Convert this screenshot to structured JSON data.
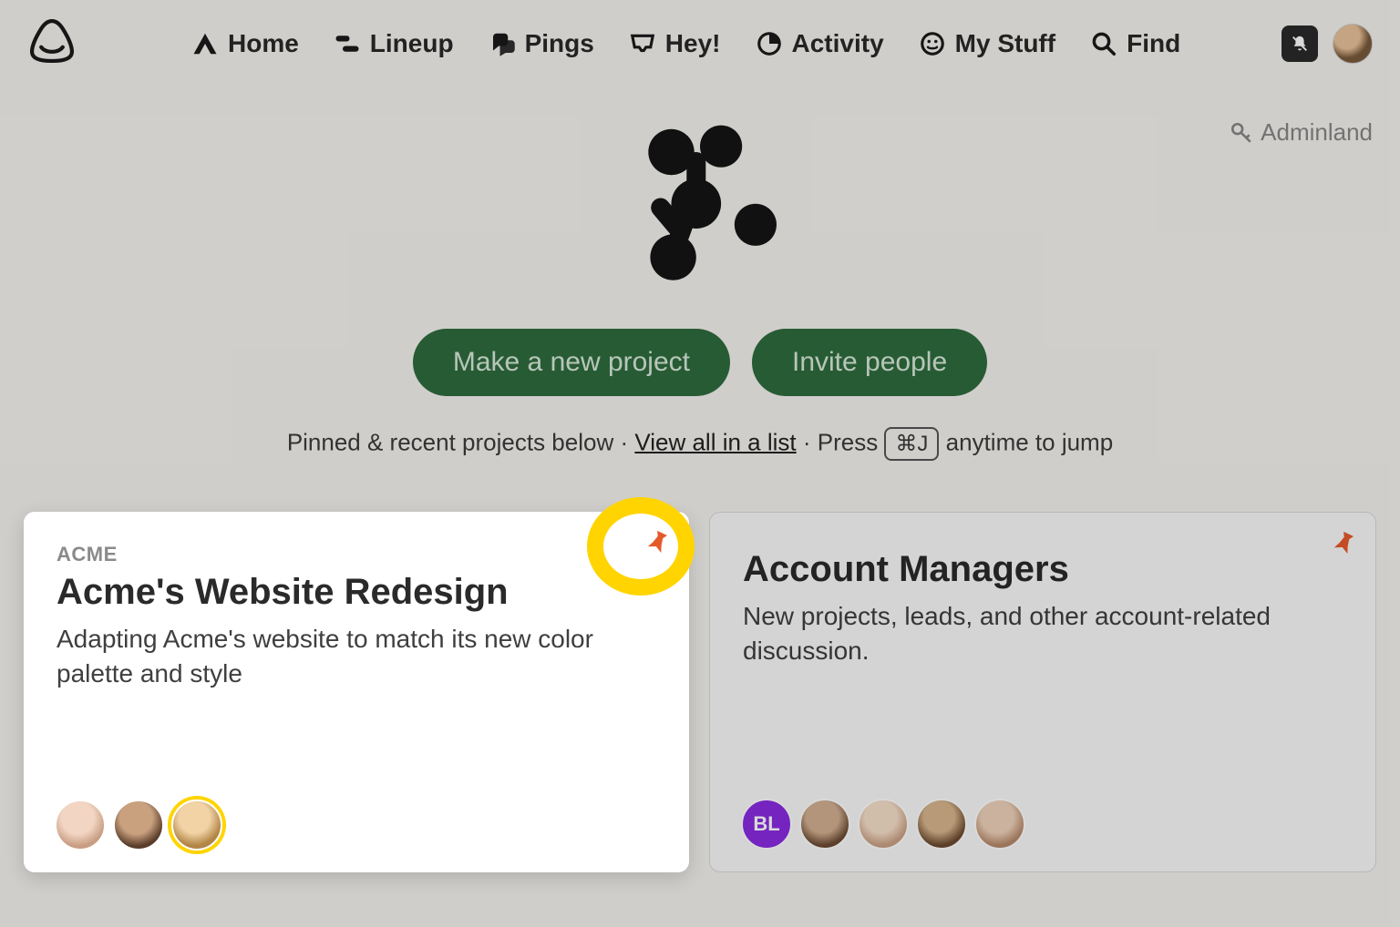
{
  "nav": {
    "items": [
      {
        "label": "Home"
      },
      {
        "label": "Lineup"
      },
      {
        "label": "Pings"
      },
      {
        "label": "Hey!"
      },
      {
        "label": "Activity"
      },
      {
        "label": "My Stuff"
      },
      {
        "label": "Find"
      }
    ]
  },
  "adminland": {
    "label": "Adminland"
  },
  "actions": {
    "new_project": "Make a new project",
    "invite": "Invite people"
  },
  "hint": {
    "prefix": "Pinned & recent projects below · ",
    "link": "View all in a list",
    "mid": " · Press ",
    "kbd": "⌘J",
    "suffix": " anytime to jump"
  },
  "cards": [
    {
      "client": "ACME",
      "title": "Acme's Website Redesign",
      "desc": "Adapting Acme's website to match its new color palette and style",
      "pinned": true,
      "highlighted": true,
      "members": [
        "face1",
        "face2",
        "face3"
      ]
    },
    {
      "client": "",
      "title": "Account Managers",
      "desc": "New projects, leads, and other account-related discussion.",
      "pinned": true,
      "highlighted": false,
      "members": [
        "badge:BL",
        "face4",
        "face5",
        "face6",
        "face7"
      ]
    }
  ],
  "colors": {
    "pin": "#e55a2b",
    "button": "#2e6b3e",
    "highlight": "#ffd400"
  }
}
